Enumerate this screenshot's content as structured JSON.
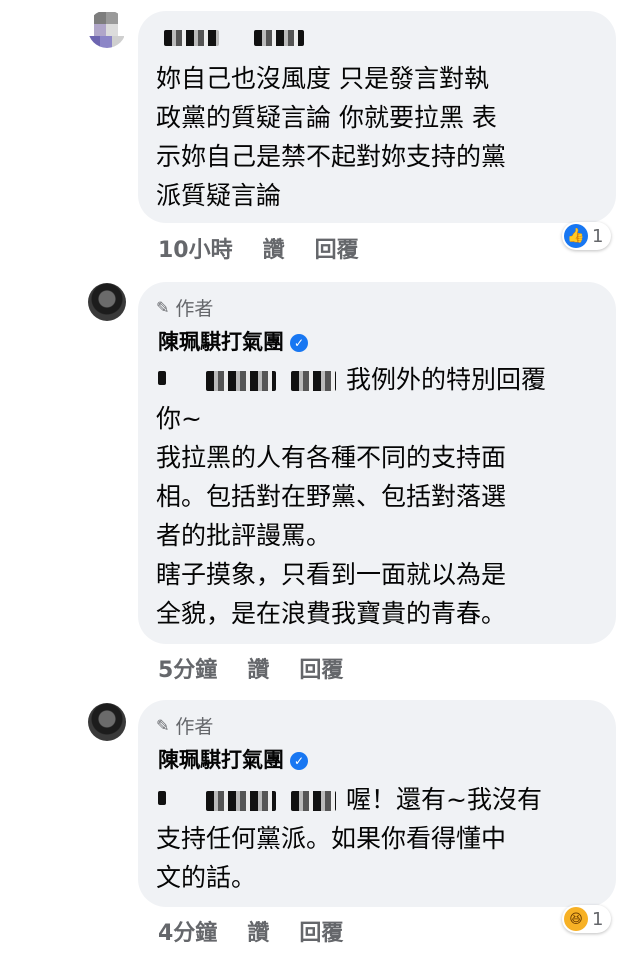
{
  "comments": [
    {
      "text_lines": [
        "妳自己也沒風度 只是發言對執",
        "政黨的質疑言論 你就要拉黑 表",
        "示妳自己是禁不起對妳支持的黨",
        "派質疑言論"
      ],
      "time": "10小時",
      "like_label": "讚",
      "reply_label": "回覆",
      "reaction_icon": "like-icon",
      "reaction_count": "1"
    },
    {
      "author_badge": "作者",
      "author_name": "陳珮騏打氣團",
      "reply_suffix": "我例外的特別回覆",
      "paragraphs": [
        "你~",
        "我拉黑的人有各種不同的支持面",
        "相。包括對在野黨、包括對落選",
        "者的批評謾罵。",
        "瞎子摸象，只看到一面就以為是",
        "全貌，是在浪費我寶貴的青春。"
      ],
      "time": "5分鐘",
      "like_label": "讚",
      "reply_label": "回覆"
    },
    {
      "author_badge": "作者",
      "author_name": "陳珮騏打氣團",
      "reply_suffix": "喔！還有~我沒有",
      "paragraphs": [
        "支持任何黨派。如果你看得懂中",
        "文的話。"
      ],
      "time": "4分鐘",
      "like_label": "讚",
      "reply_label": "回覆",
      "reaction_icon": "haha-icon",
      "reaction_count": "1"
    }
  ],
  "colors": {
    "bubble": "#f0f2f5",
    "meta": "#65676b",
    "verified": "#1877f2"
  }
}
